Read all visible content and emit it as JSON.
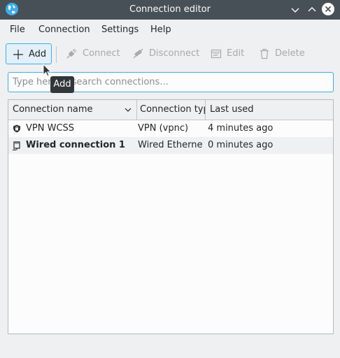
{
  "window": {
    "title": "Connection editor",
    "app_icon": "globe-icon",
    "controls": [
      "minimize-icon",
      "maximize-icon",
      "close-icon"
    ]
  },
  "menu": {
    "items": [
      "File",
      "Connection",
      "Settings",
      "Help"
    ]
  },
  "toolbar": {
    "add_label": "Add",
    "connect_label": "Connect",
    "disconnect_label": "Disconnect",
    "edit_label": "Edit",
    "delete_label": "Delete"
  },
  "search": {
    "placeholder": "Type here to search connections...",
    "value": ""
  },
  "table": {
    "columns": [
      "Connection name",
      "Connection type",
      "Last used"
    ],
    "rows": [
      {
        "name": "VPN WCSS",
        "type": "VPN (vpnc)",
        "last_used": "4 minutes ago",
        "icon": "shield-icon"
      },
      {
        "name": "Wired connection 1",
        "type": "Wired Ethernet",
        "last_used": "0 minutes ago",
        "icon": "ethernet-icon"
      }
    ]
  },
  "tooltip": {
    "text": "Add"
  },
  "colors": {
    "titlebar": "#475057",
    "accent": "#3daee9",
    "background": "#eff0f1",
    "tooltip": "#31363b"
  }
}
